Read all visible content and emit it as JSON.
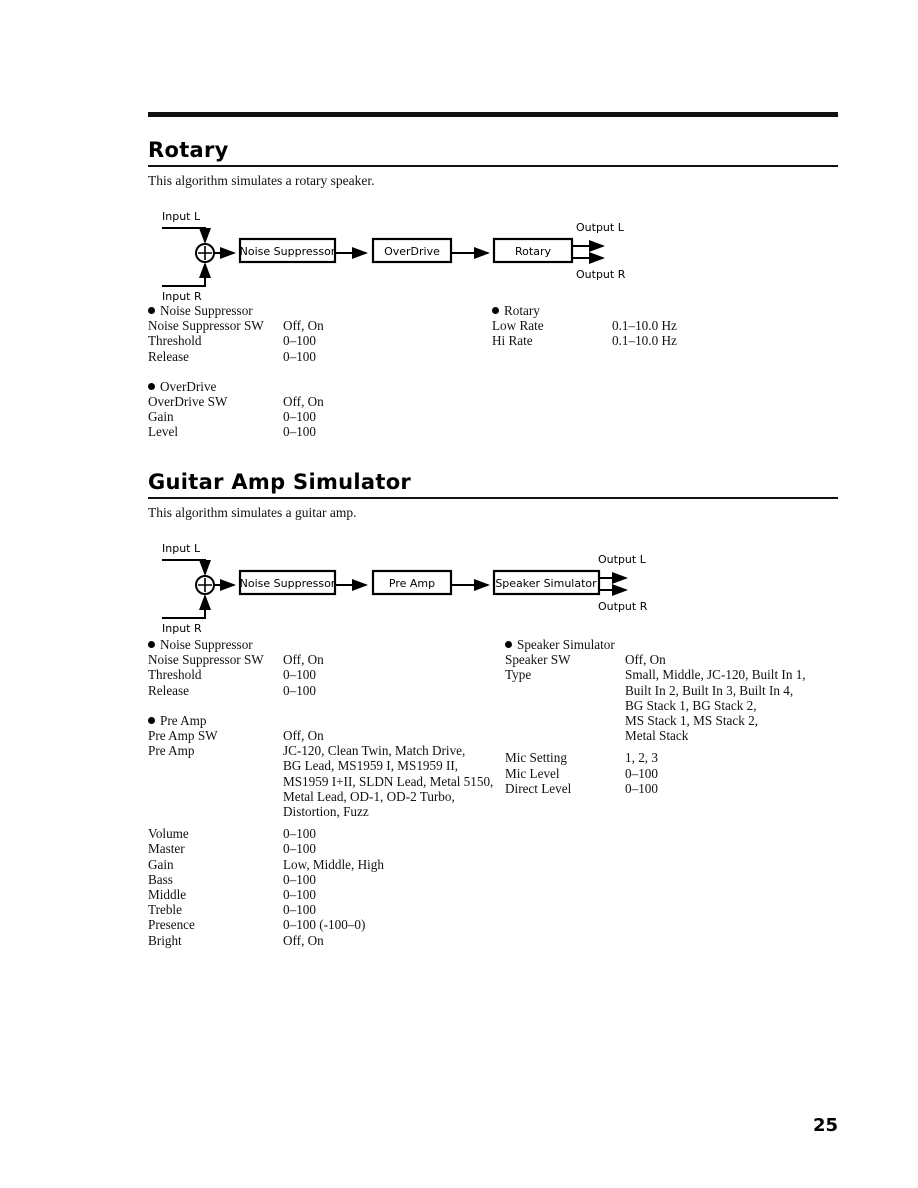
{
  "page": {
    "number": "25"
  },
  "sections": [
    {
      "title": "Rotary",
      "intro": "This algorithm simulates a rotary speaker.",
      "diagram": {
        "input_l": "Input L",
        "input_r": "Input R",
        "output_l": "Output L",
        "output_r": "Output R",
        "sum_symbol": "+",
        "blocks": [
          "Noise Suppressor",
          "OverDrive",
          "Rotary"
        ]
      },
      "left_groups": [
        {
          "name": "Noise Suppressor",
          "rows": [
            {
              "label": "Noise Suppressor SW",
              "value": "Off, On"
            },
            {
              "label": "Threshold",
              "value": "0–100"
            },
            {
              "label": "Release",
              "value": "0–100"
            }
          ]
        },
        {
          "name": "OverDrive",
          "rows": [
            {
              "label": "OverDrive SW",
              "value": "Off, On"
            },
            {
              "label": "Gain",
              "value": "0–100"
            },
            {
              "label": "Level",
              "value": "0–100"
            }
          ]
        }
      ],
      "right_groups": [
        {
          "name": "Rotary",
          "rows": [
            {
              "label": "Low Rate",
              "value": "0.1–10.0 Hz"
            },
            {
              "label": "Hi Rate",
              "value": "0.1–10.0 Hz"
            }
          ]
        }
      ]
    },
    {
      "title": "Guitar Amp Simulator",
      "intro": "This algorithm simulates a guitar amp.",
      "diagram": {
        "input_l": "Input L",
        "input_r": "Input R",
        "output_l": "Output L",
        "output_r": "Output R",
        "sum_symbol": "+",
        "blocks": [
          "Noise Suppressor",
          "Pre Amp",
          "Speaker Simulator"
        ]
      },
      "left_groups": [
        {
          "name": "Noise Suppressor",
          "rows": [
            {
              "label": "Noise Suppressor SW",
              "value": "Off, On"
            },
            {
              "label": "Threshold",
              "value": "0–100"
            },
            {
              "label": "Release",
              "value": "0–100"
            }
          ]
        },
        {
          "name": "Pre Amp",
          "rows": [
            {
              "label": "Pre Amp SW",
              "value": "Off, On"
            },
            {
              "label": "Pre Amp",
              "value": "JC-120, Clean Twin, Match Drive,",
              "continuation": [
                "BG Lead, MS1959 I, MS1959 II,",
                "MS1959 I+II, SLDN Lead, Metal 5150,",
                "Metal Lead, OD-1, OD-2 Turbo,",
                "Distortion, Fuzz"
              ]
            },
            {
              "label": "Volume",
              "value": "0–100",
              "spaced": true
            },
            {
              "label": "Master",
              "value": "0–100"
            },
            {
              "label": "Gain",
              "value": "Low, Middle, High"
            },
            {
              "label": "Bass",
              "value": "0–100"
            },
            {
              "label": "Middle",
              "value": "0–100"
            },
            {
              "label": "Treble",
              "value": "0–100"
            },
            {
              "label": "Presence",
              "value": "0–100 (-100–0)"
            },
            {
              "label": "Bright",
              "value": "Off, On"
            }
          ]
        }
      ],
      "right_groups": [
        {
          "name": "Speaker Simulator",
          "rows": [
            {
              "label": "Speaker SW",
              "value": "Off, On"
            },
            {
              "label": "Type",
              "value": "Small, Middle, JC-120, Built In 1,",
              "continuation": [
                "Built In 2, Built In 3, Built In 4,",
                "BG Stack 1, BG Stack 2,",
                "MS Stack 1, MS Stack 2,",
                "Metal Stack"
              ]
            },
            {
              "label": "Mic Setting",
              "value": "1, 2, 3"
            },
            {
              "label": "Mic Level",
              "value": "0–100"
            },
            {
              "label": "Direct Level",
              "value": "0–100"
            }
          ]
        }
      ]
    }
  ]
}
